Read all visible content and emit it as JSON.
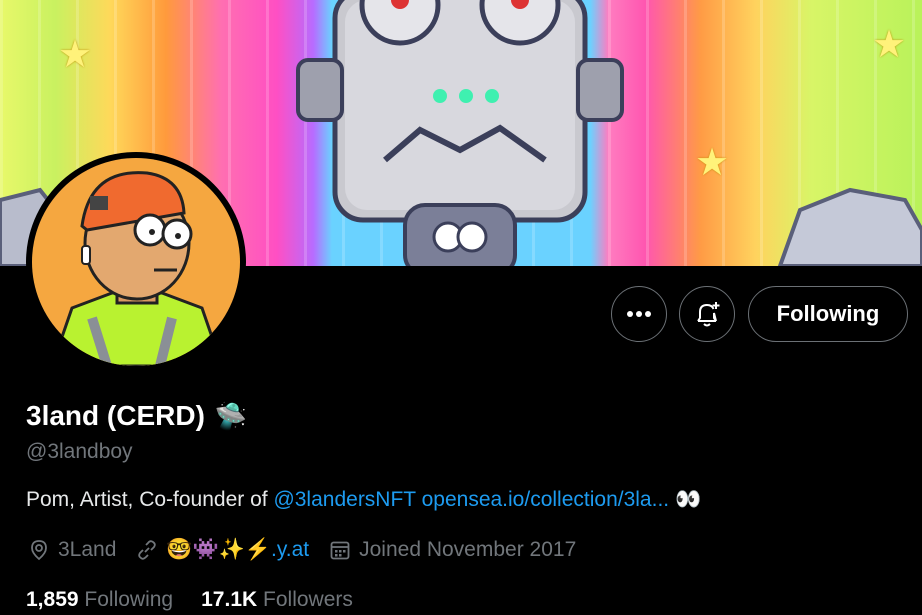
{
  "profile": {
    "display_name": "3land (CERD)",
    "name_emoji": "🛸",
    "handle": "@3landboy",
    "bio_text": "Pom, Artist, Co-founder of ",
    "bio_mention": "@3landersNFT",
    "bio_url": "opensea.io/collection/3la...",
    "bio_emoji": "👀",
    "location": "3Land",
    "website_emoji": "🤓👾✨⚡",
    "website_domain": ".y.at",
    "joined": "Joined November 2017",
    "following_count": "1,859",
    "following_label": "Following",
    "followers_count": "17.1K",
    "followers_label": "Followers"
  },
  "actions": {
    "more_label": "•••",
    "following_button": "Following"
  },
  "colors": {
    "background": "#000000",
    "link": "#1d9bf0",
    "muted": "#71767b",
    "border": "#6b7075"
  },
  "icons": [
    "more-icon",
    "bell-plus-icon",
    "location-icon",
    "link-icon",
    "calendar-icon"
  ]
}
